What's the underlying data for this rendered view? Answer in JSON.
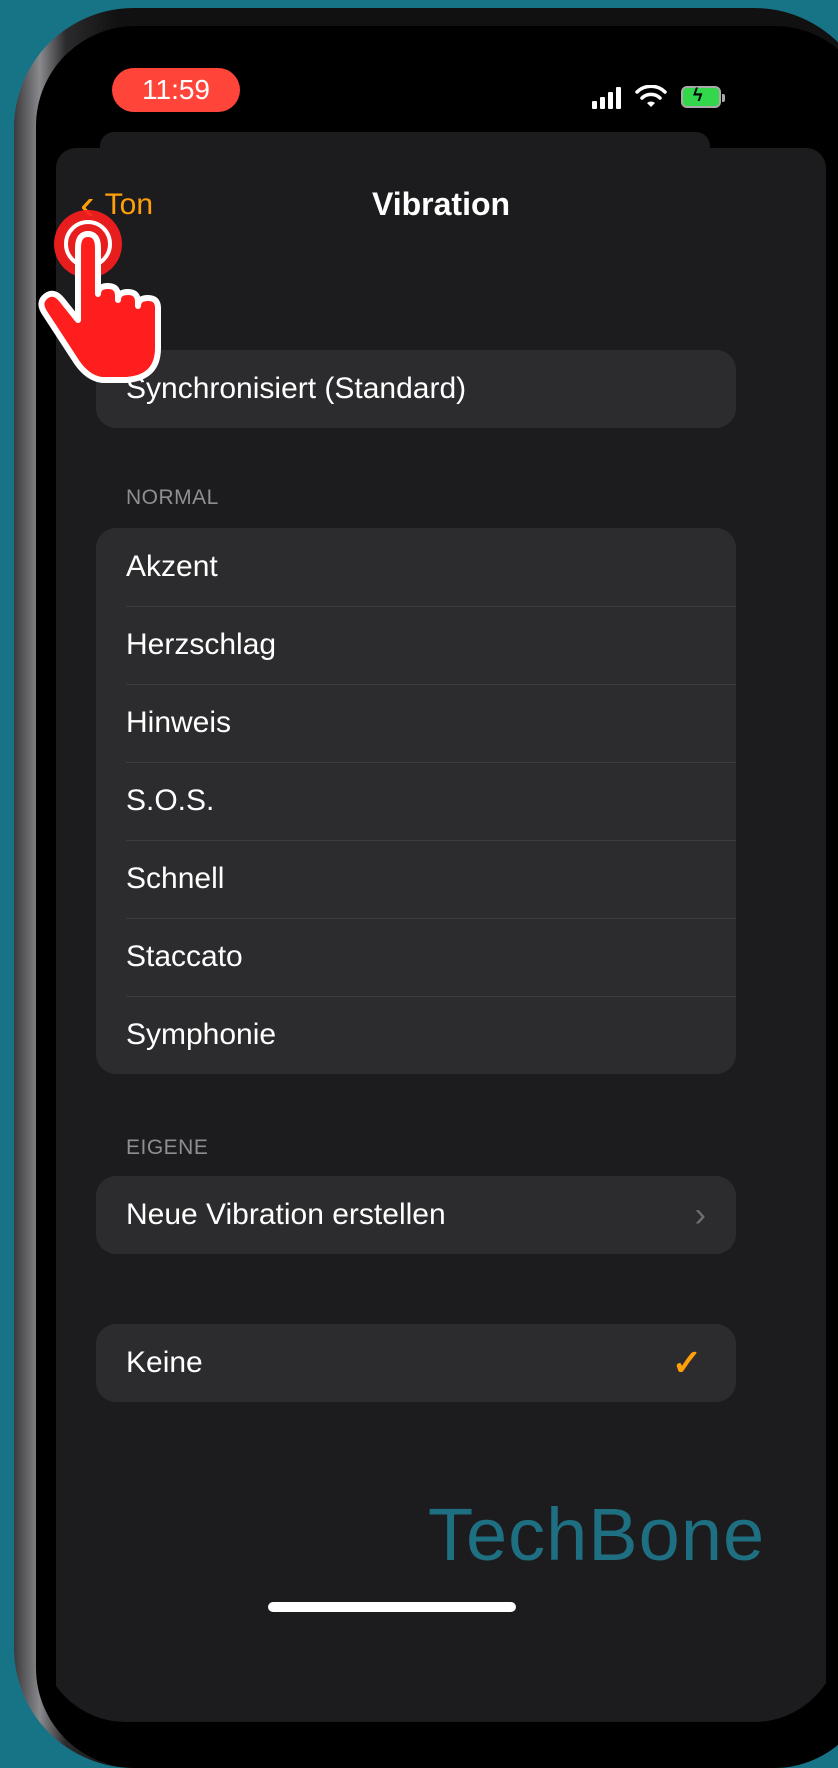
{
  "status": {
    "time": "11:59"
  },
  "nav": {
    "back_label": "Ton",
    "title": "Vibration"
  },
  "synced": {
    "label": "Synchronisiert (Standard)"
  },
  "normal": {
    "header": "NORMAL",
    "items": [
      "Akzent",
      "Herzschlag",
      "Hinweis",
      "S.O.S.",
      "Schnell",
      "Staccato",
      "Symphonie"
    ]
  },
  "custom": {
    "header": "EIGENE",
    "create_label": "Neue Vibration erstellen"
  },
  "none": {
    "label": "Keine"
  },
  "watermark": "TechBone",
  "colors": {
    "accent": "#ff9f0a",
    "background": "#177486",
    "tap_red": "#ff1e1e"
  }
}
